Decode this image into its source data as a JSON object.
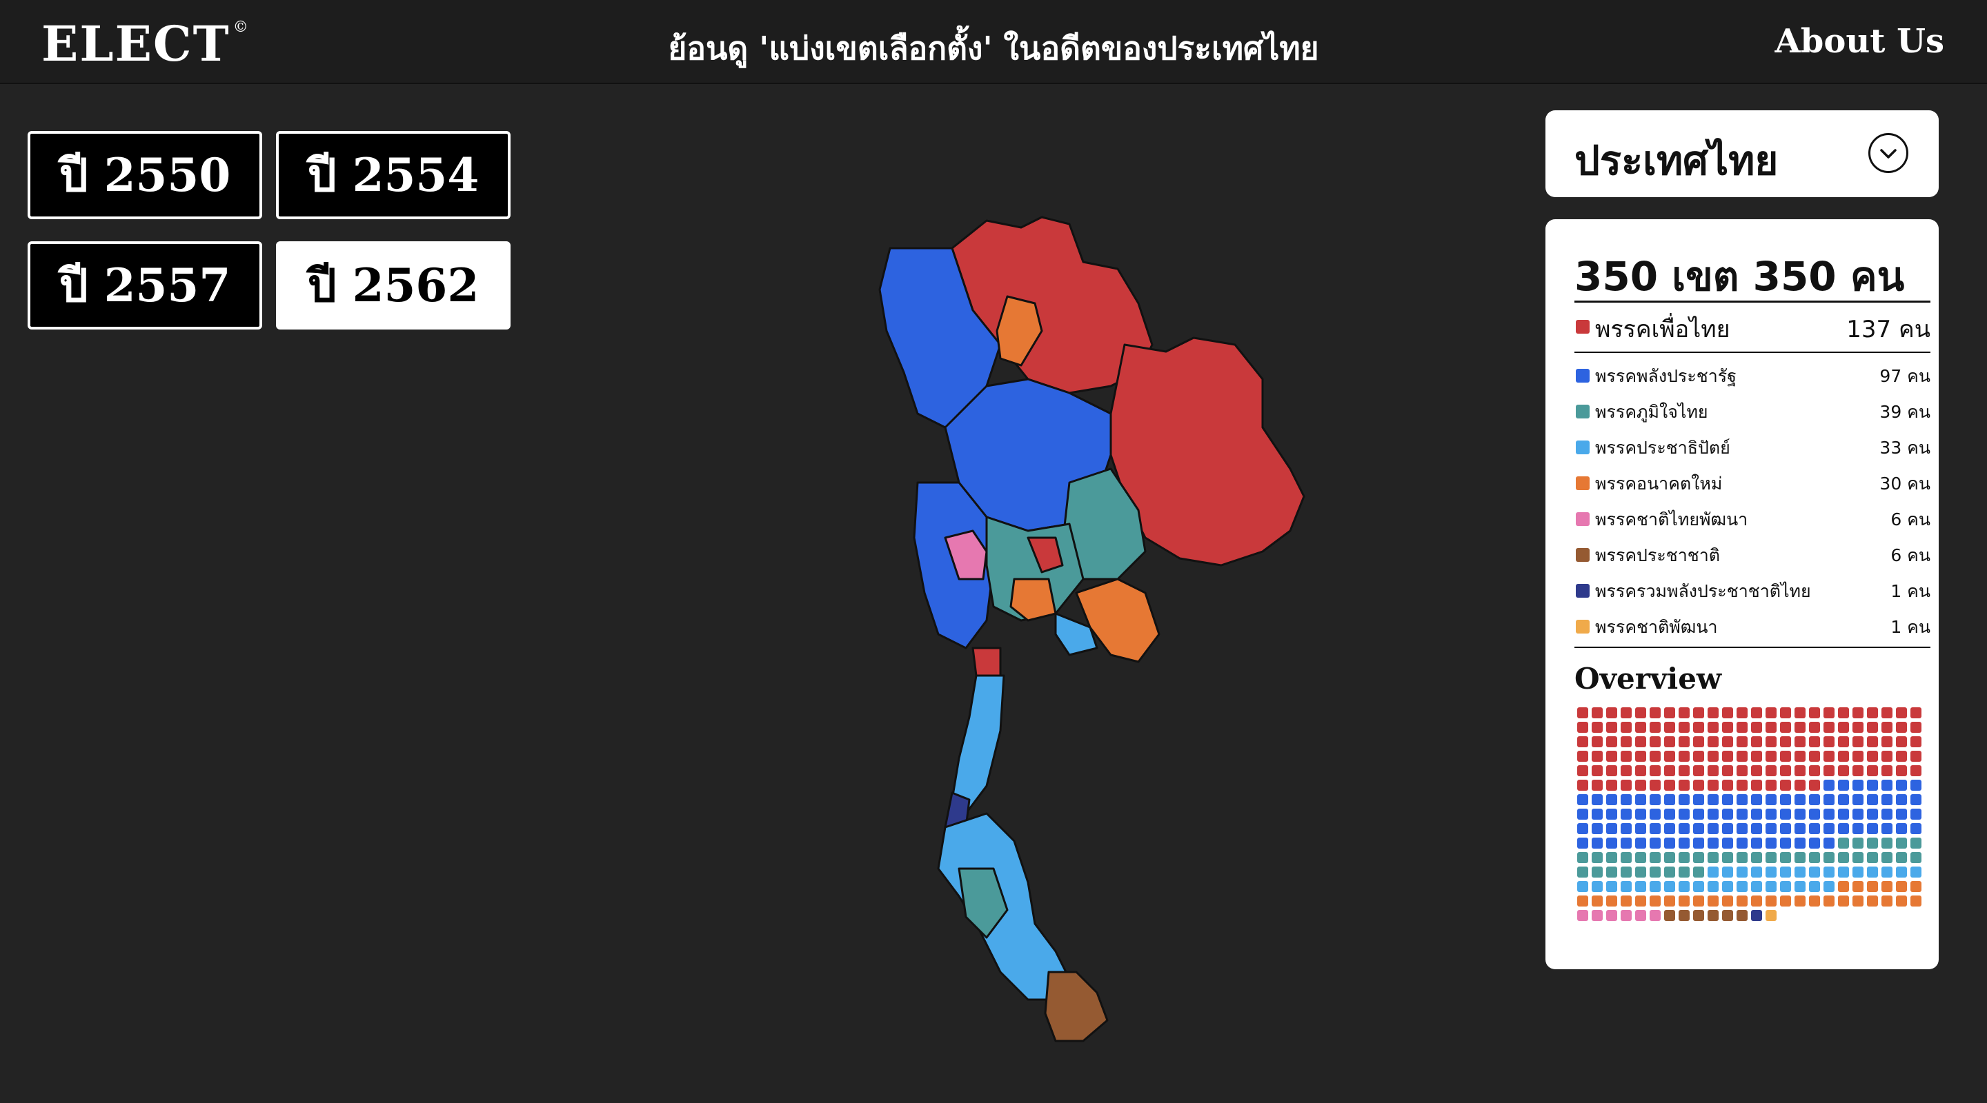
{
  "header": {
    "logo": "ELECT",
    "logo_mark": "©",
    "title": "ย้อนดู 'แบ่งเขตเลือกตั้ง' ในอดีตของประเทศไทย",
    "about": "About Us"
  },
  "years": [
    {
      "label": "ปี 2550",
      "active": false
    },
    {
      "label": "ปี 2554",
      "active": false
    },
    {
      "label": "ปี 2557",
      "active": false
    },
    {
      "label": "ปี 2562",
      "active": true
    }
  ],
  "region": {
    "selected": "ประเทศไทย",
    "icon": "chevron-down-icon"
  },
  "summary": {
    "headline": "350 เขต 350 คน",
    "total_seats": 350,
    "leader": {
      "name": "พรรคเพื่อไทย",
      "count": "137 คน",
      "color": "#c9393b"
    },
    "parties": [
      {
        "name": "พรรคพลังประชารัฐ",
        "count": "97 คน",
        "seats": 97,
        "color": "#2d63e0"
      },
      {
        "name": "พรรคภูมิใจไทย",
        "count": "39 คน",
        "seats": 39,
        "color": "#4b9a9a"
      },
      {
        "name": "พรรคประชาธิปัตย์",
        "count": "33 คน",
        "seats": 33,
        "color": "#4aa9ea"
      },
      {
        "name": "พรรคอนาคตใหม่",
        "count": "30 คน",
        "seats": 30,
        "color": "#e67834"
      },
      {
        "name": "พรรคชาติไทยพัฒนา",
        "count": "6 คน",
        "seats": 6,
        "color": "#e678b0"
      },
      {
        "name": "พรรคประชาชาติ",
        "count": "6 คน",
        "seats": 6,
        "color": "#955a32"
      },
      {
        "name": "พรรครวมพลังประชาชาติไทย",
        "count": "1 คน",
        "seats": 1,
        "color": "#2e3a8c"
      },
      {
        "name": "พรรคชาติพัฒนา",
        "count": "1 คน",
        "seats": 1,
        "color": "#f0aa4a"
      }
    ],
    "leader_seats": 137,
    "overview_title": "Overview"
  }
}
